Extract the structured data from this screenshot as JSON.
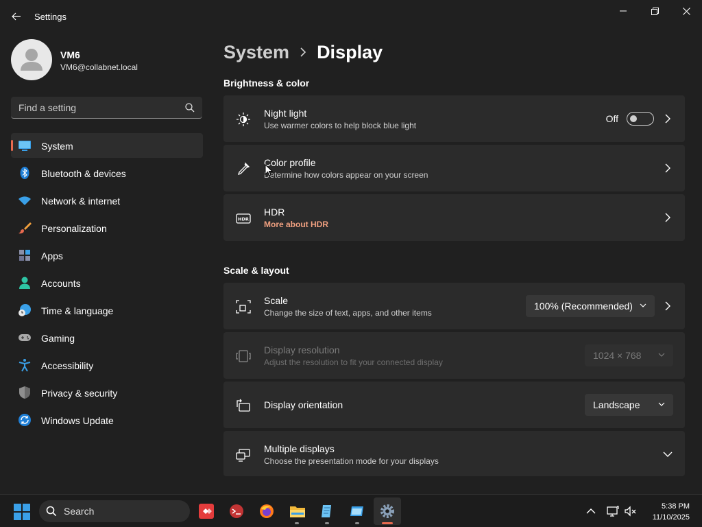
{
  "window": {
    "title": "Settings",
    "back_label": "Back",
    "minimize_label": "Minimize",
    "restore_label": "Restore",
    "close_label": "Close"
  },
  "profile": {
    "name": "VM6",
    "email": "VM6@collabnet.local"
  },
  "search": {
    "placeholder": "Find a setting"
  },
  "nav": {
    "items": [
      {
        "label": "System",
        "icon": "system-icon",
        "active": true
      },
      {
        "label": "Bluetooth & devices",
        "icon": "bluetooth-icon"
      },
      {
        "label": "Network & internet",
        "icon": "wifi-icon"
      },
      {
        "label": "Personalization",
        "icon": "brush-icon"
      },
      {
        "label": "Apps",
        "icon": "apps-icon"
      },
      {
        "label": "Accounts",
        "icon": "person-icon"
      },
      {
        "label": "Time & language",
        "icon": "globe-clock-icon"
      },
      {
        "label": "Gaming",
        "icon": "controller-icon"
      },
      {
        "label": "Accessibility",
        "icon": "accessibility-icon"
      },
      {
        "label": "Privacy & security",
        "icon": "shield-icon"
      },
      {
        "label": "Windows Update",
        "icon": "update-icon"
      }
    ]
  },
  "breadcrumb": {
    "parent": "System",
    "current": "Display"
  },
  "sections": {
    "brightness": "Brightness & color",
    "scale": "Scale & layout"
  },
  "cards": {
    "night_light": {
      "title": "Night light",
      "subtitle": "Use warmer colors to help block blue light",
      "toggle_state": "Off",
      "icon": "night-light-icon"
    },
    "color_profile": {
      "title": "Color profile",
      "subtitle": "Determine how colors appear on your screen",
      "icon": "eyedropper-icon"
    },
    "hdr": {
      "title": "HDR",
      "link": "More about HDR",
      "icon": "hdr-icon"
    },
    "scale": {
      "title": "Scale",
      "subtitle": "Change the size of text, apps, and other items",
      "value": "100% (Recommended)",
      "icon": "scale-icon"
    },
    "resolution": {
      "title": "Display resolution",
      "subtitle": "Adjust the resolution to fit your connected display",
      "value": "1024 × 768",
      "icon": "resolution-icon",
      "disabled": true
    },
    "orientation": {
      "title": "Display orientation",
      "value": "Landscape",
      "icon": "orientation-icon"
    },
    "multiple": {
      "title": "Multiple displays",
      "subtitle": "Choose the presentation mode for your displays",
      "icon": "multiple-displays-icon"
    }
  },
  "taskbar": {
    "search_label": "Search",
    "apps": [
      "anydesk-icon",
      "terminal-app-icon",
      "firefox-icon",
      "file-explorer-icon",
      "notepad-icon",
      "window-app-icon",
      "settings-icon"
    ],
    "time": "5:38 PM",
    "date": "11/10/2025"
  },
  "colors": {
    "background": "#202020",
    "card": "#2b2b2b",
    "accent": "#e86a4f",
    "link": "#f0a080"
  }
}
